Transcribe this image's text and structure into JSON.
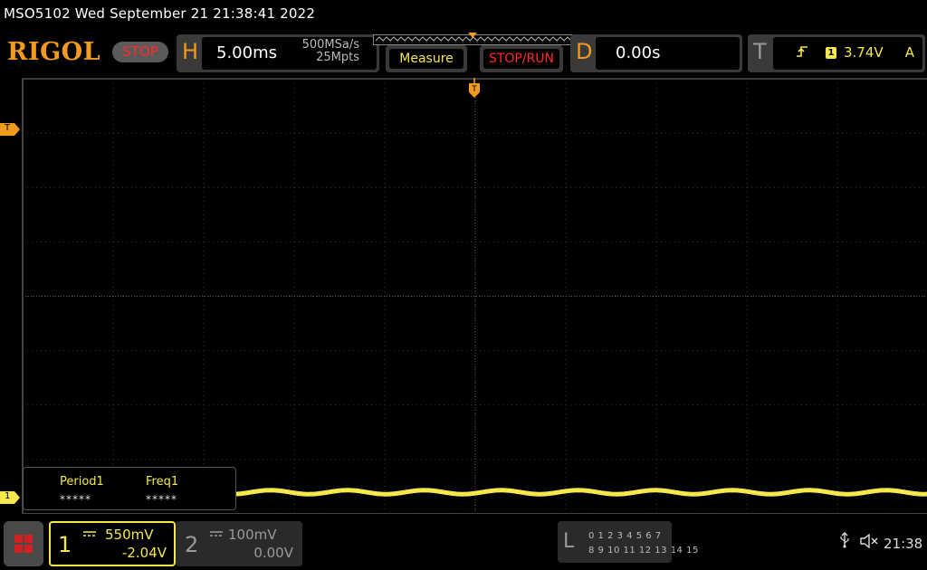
{
  "title": "MSO5102  Wed September 21 21:38:41 2022",
  "brand": {
    "logo": "RIGOL",
    "run_state": "STOP"
  },
  "horizontal": {
    "letter": "H",
    "timebase": "5.00ms",
    "sample_rate": "500MSa/s",
    "memory_depth": "25Mpts"
  },
  "buttons": {
    "measure": "Measure",
    "stop_run": "STOP/RUN"
  },
  "delay": {
    "letter": "D",
    "value": "0.00s"
  },
  "trigger": {
    "letter": "T",
    "source_channel": "1",
    "level": "3.74V",
    "mode": "A"
  },
  "markers": {
    "trigger_top": "T",
    "trigger_level": "T",
    "channel1_ground": "1"
  },
  "measurements": [
    {
      "name": "Period1",
      "value": "*****"
    },
    {
      "name": "Freq1",
      "value": "*****"
    }
  ],
  "channels": [
    {
      "number": "1",
      "scale": "550mV",
      "offset": "-2.04V",
      "active": true
    },
    {
      "number": "2",
      "scale": "100mV",
      "offset": "0.00V",
      "active": false
    }
  ],
  "logic": {
    "letter": "L",
    "row1": "0 1 2 3   4 5 6 7",
    "row2": "8 9 10 11  12 13 14 15"
  },
  "status": {
    "clock": "21:38"
  },
  "colors": {
    "brand_orange": "#f29a1d",
    "channel1_yellow": "#f6e84a",
    "stop_red": "#ff2a2a",
    "panel_gray": "#3a3a3a"
  },
  "icons": [
    "menu-grid-icon",
    "usb-icon",
    "speaker-muted-icon",
    "trigger-edge-icon",
    "dc-coupling-icon"
  ]
}
